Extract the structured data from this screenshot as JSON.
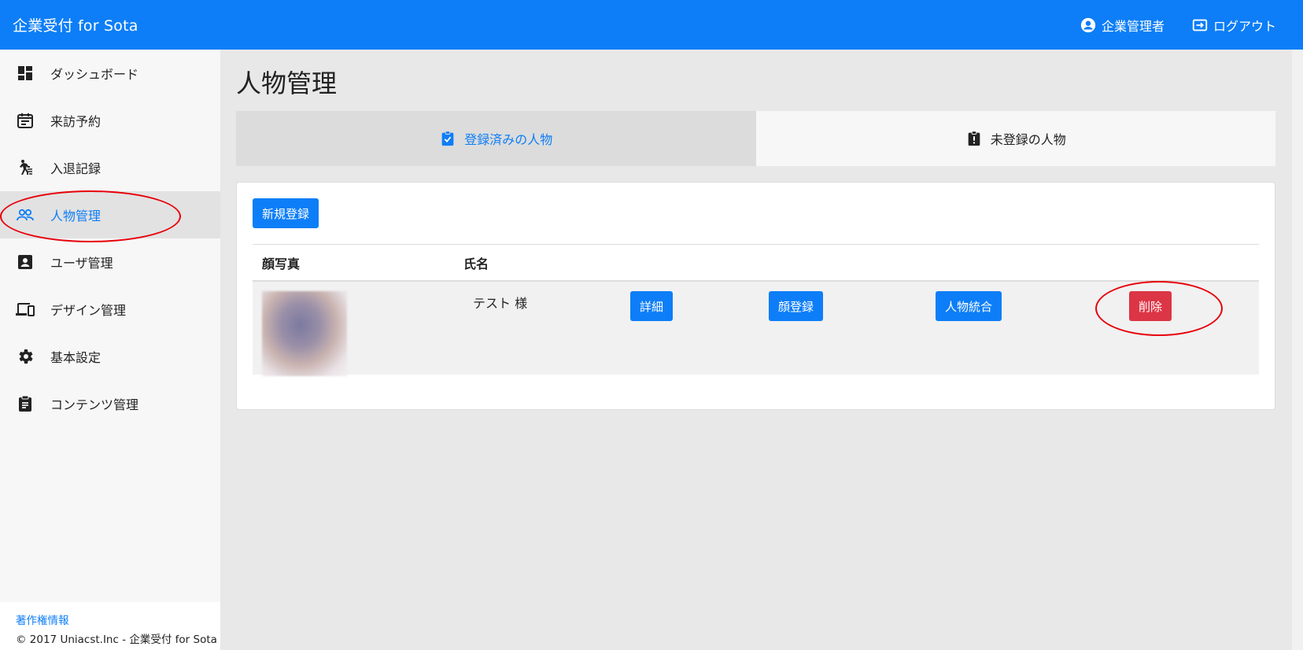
{
  "header": {
    "app_title": "企業受付 for Sota",
    "user_label": "企業管理者",
    "logout_label": "ログアウト"
  },
  "sidebar": {
    "items": [
      {
        "label": "ダッシュボード",
        "icon": "dashboard-icon"
      },
      {
        "label": "来訪予約",
        "icon": "calendar-icon"
      },
      {
        "label": "入退記録",
        "icon": "walking-person-icon"
      },
      {
        "label": "人物管理",
        "icon": "people-icon",
        "active": true
      },
      {
        "label": "ユーザ管理",
        "icon": "user-badge-icon"
      },
      {
        "label": "デザイン管理",
        "icon": "devices-icon"
      },
      {
        "label": "基本設定",
        "icon": "gear-icon"
      },
      {
        "label": "コンテンツ管理",
        "icon": "clipboard-icon"
      }
    ],
    "footer_link": "著作権情報",
    "footer_text": "© 2017 Uniacst.Inc - 企業受付 for Sota"
  },
  "main": {
    "page_title": "人物管理",
    "tabs": [
      {
        "label": "登録済みの人物",
        "icon": "clipboard-check-icon",
        "active": true
      },
      {
        "label": "未登録の人物",
        "icon": "clipboard-alert-icon",
        "active": false
      }
    ],
    "new_button": "新規登録",
    "table": {
      "headers": [
        "顔写真",
        "氏名"
      ],
      "rows": [
        {
          "name": "テスト 様",
          "buttons": {
            "detail": "詳細",
            "face_register": "顔登録",
            "merge": "人物統合",
            "delete": "削除"
          }
        }
      ]
    }
  },
  "colors": {
    "accent": "#0d7ef7",
    "danger": "#dc3545",
    "annotation": "#e8000a"
  }
}
